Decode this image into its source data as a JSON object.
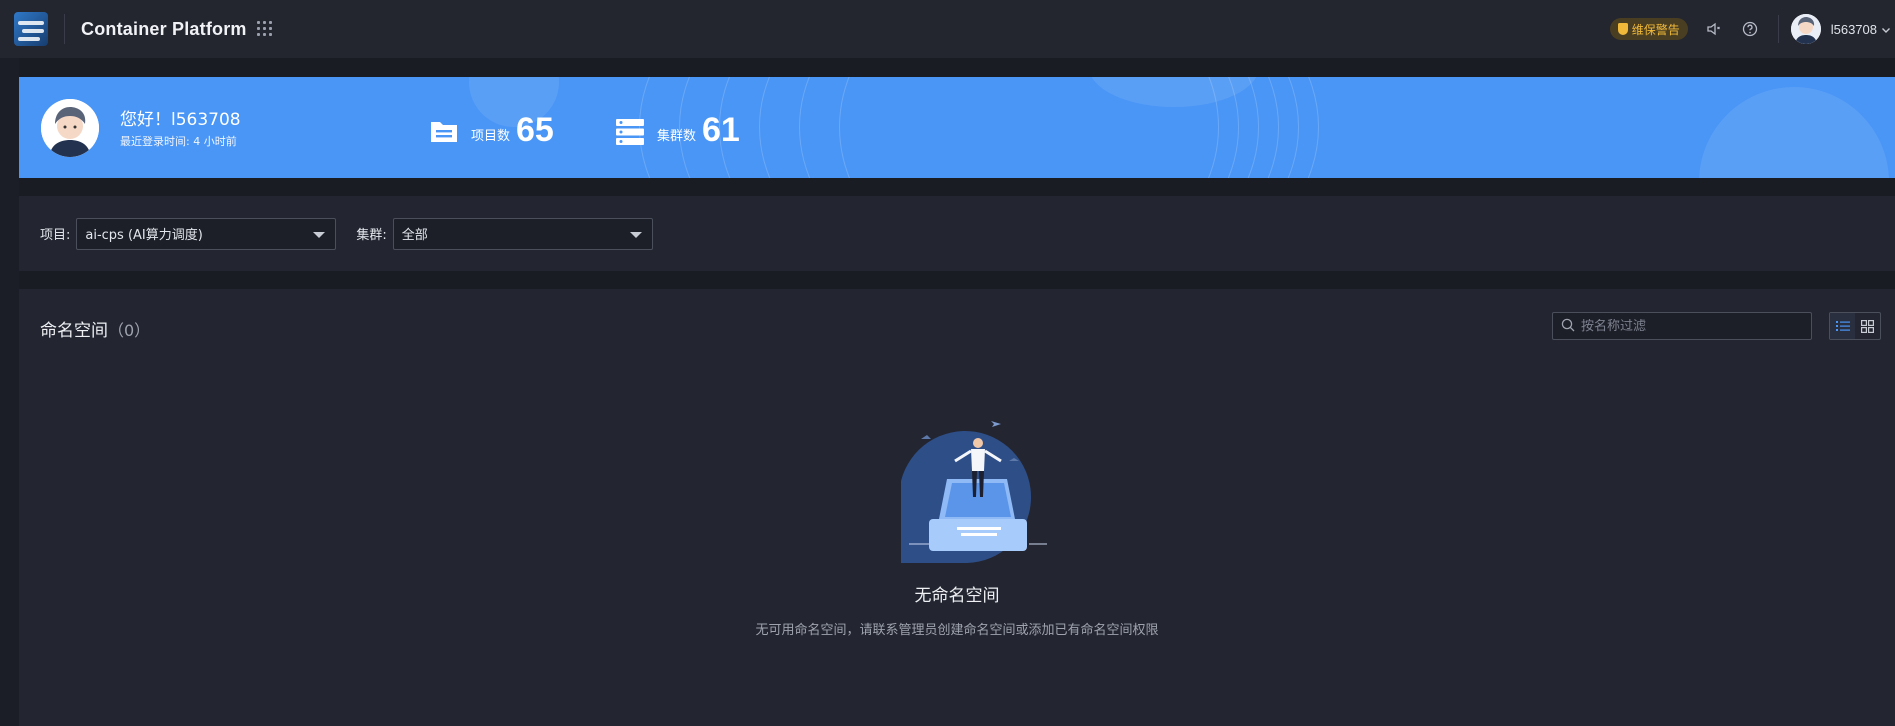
{
  "header": {
    "app_title": "Container Platform",
    "warning_badge": "维保警告",
    "username": "l563708"
  },
  "banner": {
    "greeting": "您好！l563708",
    "last_login_label": "最近登录时间:",
    "last_login_value": "4 小时前",
    "projects_label": "项目数",
    "projects_count": "65",
    "clusters_label": "集群数",
    "clusters_count": "61",
    "color": "#4a96f6"
  },
  "filters": {
    "project_label": "项目:",
    "project_value": "ai-cps (AI算力调度)",
    "cluster_label": "集群:",
    "cluster_value": "全部"
  },
  "namespaces": {
    "title": "命名空间",
    "count": "（0）",
    "search_placeholder": "按名称过滤",
    "empty_title": "无命名空间",
    "empty_desc": "无可用命名空间，请联系管理员创建命名空间或添加已有命名空间权限"
  },
  "icons": [
    "apps-grid-icon",
    "shield-icon",
    "speaker-icon",
    "help-icon",
    "chevron-down-icon",
    "folder-icon",
    "server-icon",
    "search-icon",
    "list-view-icon",
    "grid-view-icon"
  ]
}
